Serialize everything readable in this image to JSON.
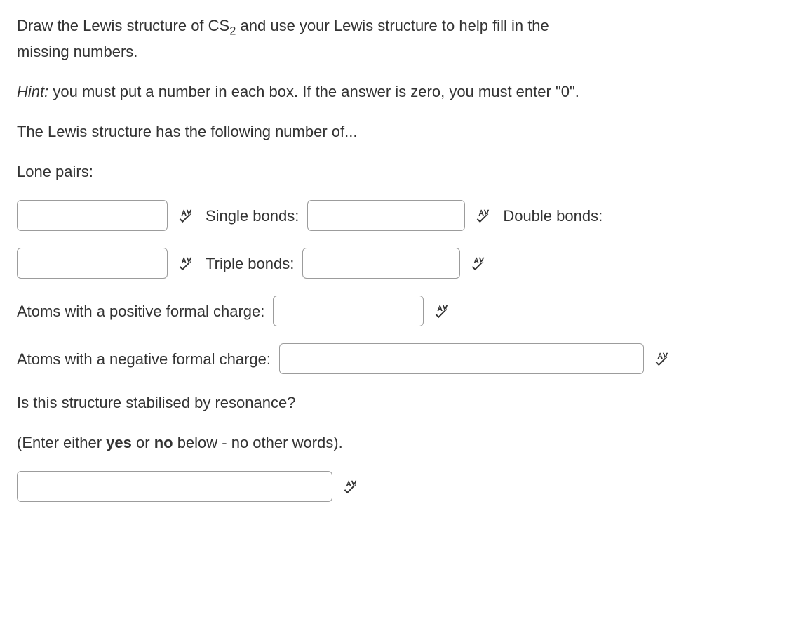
{
  "question": {
    "line1_pre": "Draw the Lewis structure of CS",
    "line1_sub": "2",
    "line1_post": " and use your Lewis structure to help fill in the",
    "line2": "missing numbers."
  },
  "hint": {
    "label": "Hint:",
    "text": " you must put a number in each box. If the answer is zero, you must enter \"0\"."
  },
  "intro": "The Lewis structure has the following number of...",
  "labels": {
    "lone_pairs": "Lone pairs:",
    "single_bonds": "Single bonds:",
    "double_bonds": "Double bonds:",
    "triple_bonds": "Triple bonds:",
    "pos_formal_charge": "Atoms with a positive formal charge:",
    "neg_formal_charge": "Atoms with a negative formal charge:",
    "resonance_q": "Is this structure stabilised by resonance?",
    "resonance_instr_pre": "(Enter either ",
    "resonance_yes": "yes",
    "resonance_mid": " or ",
    "resonance_no": "no",
    "resonance_instr_post": " below - no other words)."
  },
  "inputs": {
    "lone_pairs": "",
    "single_bonds": "",
    "double_bonds": "",
    "triple_bonds": "",
    "pos_formal_charge": "",
    "neg_formal_charge": "",
    "resonance": ""
  }
}
